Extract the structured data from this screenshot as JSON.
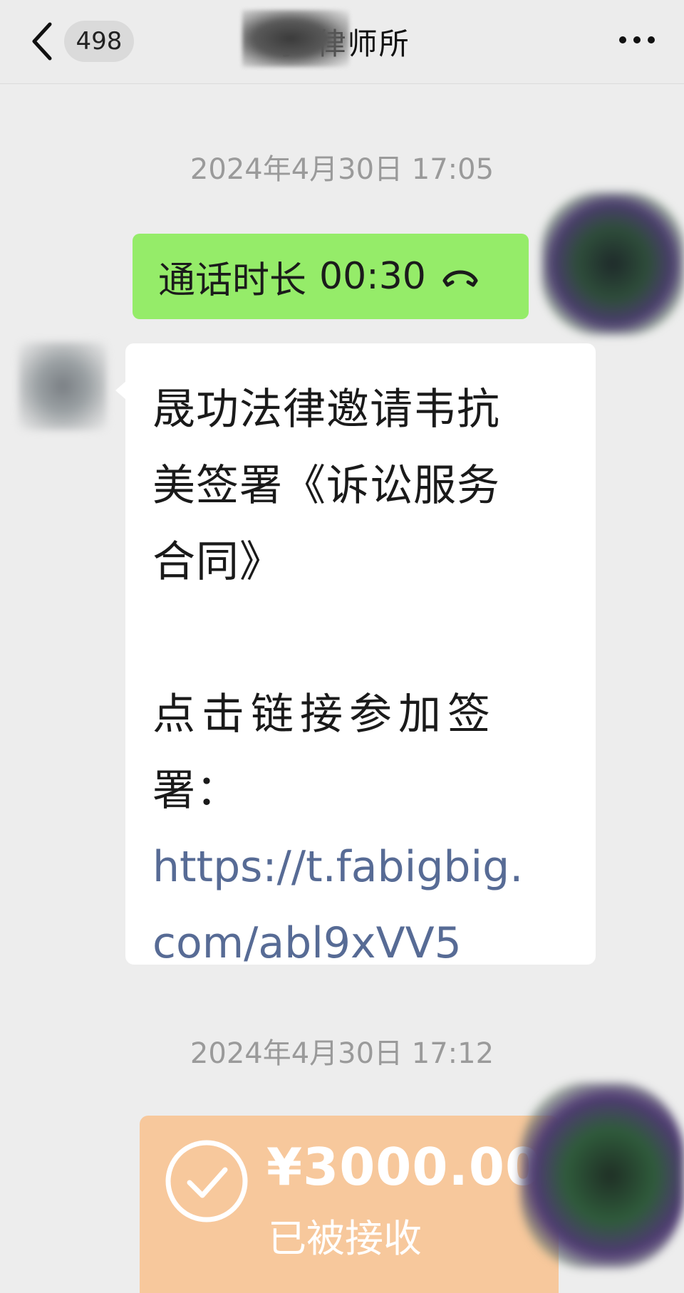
{
  "header": {
    "unread_count": "498",
    "title": "李            律师所"
  },
  "messages": [
    {
      "type": "timestamp",
      "text": "2024年4月30日 17:05"
    },
    {
      "type": "call",
      "direction": "outgoing",
      "label": "通话时长",
      "duration": "00:30"
    },
    {
      "type": "text",
      "direction": "incoming",
      "lines": [
        "晟功法律邀请韦抗",
        "美签署《诉讼服务",
        "合同》"
      ],
      "lines2": [
        "点击链接参加签",
        "署："
      ],
      "link_lines": [
        "https://t.fabigbig.",
        "com/abl9xVV5"
      ]
    },
    {
      "type": "timestamp",
      "text": "2024年4月30日 17:12"
    },
    {
      "type": "transfer",
      "direction": "outgoing",
      "amount": "¥3000.00",
      "status": "已被接收"
    }
  ],
  "colors": {
    "background": "#ededed",
    "outgoing_bubble": "#95ec69",
    "incoming_bubble": "#ffffff",
    "link": "#576b95",
    "transfer_card": "#f7c89c",
    "timestamp": "#9a9a9a"
  },
  "icons": {
    "back": "chevron-left-icon",
    "more": "ellipsis-icon",
    "call": "phone-hangup-icon",
    "transfer_done": "check-circle-icon"
  }
}
